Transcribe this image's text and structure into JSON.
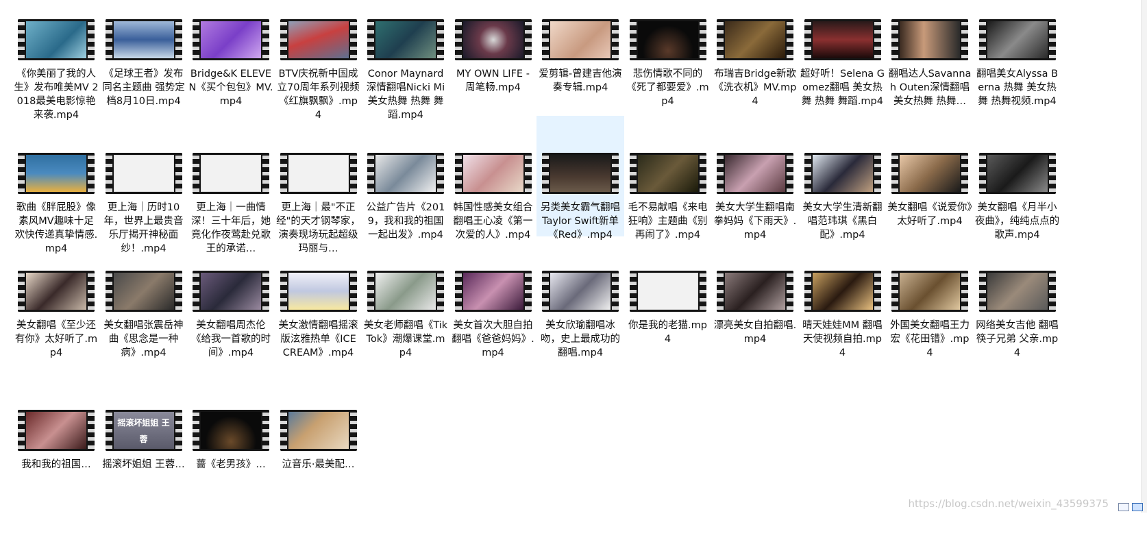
{
  "files": [
    {
      "caption": "《你美丽了我的人生》发布唯美MV 2018最美电影惊艳来袭.mp4",
      "bg": "linear-gradient(135deg,#6fb0c8,#2a6a8a 60%,#9fd0e0)"
    },
    {
      "caption": "《足球王者》发布同名主题曲 强势定档8月10日.mp4",
      "bg": "linear-gradient(180deg,#9fb8d8,#3a5f9a 50%,#c8d8e8)"
    },
    {
      "caption": "Bridge&K ELEVEN《买个包包》MV.mp4",
      "bg": "linear-gradient(135deg,#b07ae0,#7a3fc8 50%,#d0a8f0)"
    },
    {
      "caption": "BTV庆祝新中国成立70周年系列视频《红旗飘飘》.mp4",
      "bg": "linear-gradient(160deg,#8fa0b8,#c84040 45%,#5f7090)"
    },
    {
      "caption": "Conor Maynard深情翻唱Nicki Mi 美女热舞 热舞 舞蹈.mp4",
      "bg": "linear-gradient(135deg,#2f6f6f,#1f3f4f 50%,#6f8f7f)"
    },
    {
      "caption": "MY OWN LIFE - 周笔畅.mp4",
      "bg": "radial-gradient(circle at 50% 50%,#d8d8d8,#6a3a4a 40%,#1a1a2a)"
    },
    {
      "caption": "爱剪辑-曾建吉他演奏专辑.mp4",
      "bg": "linear-gradient(135deg,#f0d8c8,#c89a80 60%,#e8c8b8)"
    },
    {
      "caption": "悲伤情歌不同的《死了都要爱》.mp4",
      "bg": "radial-gradient(circle at 50% 80%,#5a3a2a,#0a0a0a 60%)"
    },
    {
      "caption": "布瑞吉Bridge新歌《洗衣机》MV.mp4",
      "bg": "linear-gradient(135deg,#3a2a1a,#8a6a3a 50%,#2a1a0a)"
    },
    {
      "caption": "超好听！Selena Gomez翻唱 美女热舞 热舞 舞蹈.mp4",
      "bg": "linear-gradient(180deg,#2a1a1a,#8a3030 50%,#1a0a0a)"
    },
    {
      "caption": "翻唱达人Savannah Outen深情翻唱 美女热舞 热舞…",
      "bg": "linear-gradient(90deg,#3a2a20,#c89a7a 40%,#2a2a2a)"
    },
    {
      "caption": "翻唱美女Alyssa Berna 热舞 美女热舞 热舞视频.mp4",
      "bg": "linear-gradient(135deg,#1a1a1a,#8a8a8a 50%,#2a2a2a)"
    },
    {
      "caption": "歌曲《胖屁股》像素风MV趣味十足 欢快传递真挚情感.mp4",
      "bg": "linear-gradient(180deg,#2f6fa0,#4a8ac0 50%,#e8b040)"
    },
    {
      "caption": "更上海｜历时10年，世界上最贵音乐厅揭开神秘面纱！.mp4",
      "bg": "",
      "plain": true
    },
    {
      "caption": "更上海｜一曲情深！三十年后，她竟化作夜莺赴兑歌王的承诺…",
      "bg": "",
      "plain": true
    },
    {
      "caption": "更上海｜最\"不正经\"的天才钢琴家，演奏现场玩起超级玛丽与…",
      "bg": "",
      "plain": true
    },
    {
      "caption": "公益广告片《2019，我和我的祖国一起出发》.mp4",
      "bg": "linear-gradient(135deg,#e8e8e8,#7a8a9a 50%,#f0f0f0)"
    },
    {
      "caption": "韩国性感美女组合翻唱王心凌《第一次爱的人》.mp4",
      "bg": "linear-gradient(135deg,#f0e0e8,#c89090 50%,#e8d8c8)"
    },
    {
      "caption": "另类美女霸气翻唱Taylor Swift新单《Red》.mp4",
      "bg": "linear-gradient(180deg,#1a1a1a,#4a3a30 60%,#6a5a4a)",
      "selected": true
    },
    {
      "caption": "毛不易献唱《来电狂响》主题曲《别再闹了》.mp4",
      "bg": "linear-gradient(135deg,#2a2a1a,#6a5a3a 50%,#1a1a0a)"
    },
    {
      "caption": "美女大学生翻唱南拳妈妈《下雨天》.mp4",
      "bg": "linear-gradient(135deg,#3a2a30,#c8a0b0 50%,#5a3a40)"
    },
    {
      "caption": "美女大学生清新翻唱范玮琪《黑白配》.mp4",
      "bg": "linear-gradient(135deg,#e0e8f0,#2a2a3a 50%,#c0a080)"
    },
    {
      "caption": "美女翻唱《说爱你》太好听了.mp4",
      "bg": "linear-gradient(135deg,#e8c8a8,#8a6a4a 50%,#1a1a1a)"
    },
    {
      "caption": "美女翻唱《月半小夜曲》，纯纯点点的歌声.mp4",
      "bg": "linear-gradient(135deg,#5a5a5a,#1a1a1a 50%,#8a8a8a)"
    },
    {
      "caption": "美女翻唱《至少还有你》太好听了.mp4",
      "bg": "linear-gradient(135deg,#e8d8c8,#3a2a2a 50%,#c8b8a8)"
    },
    {
      "caption": "美女翻唱张震岳神曲《思念是一种病》.mp4",
      "bg": "linear-gradient(135deg,#4a4a4a,#8a7a6a 50%,#2a2a2a)"
    },
    {
      "caption": "美女翻唱周杰伦《给我一首歌的时间》.mp4",
      "bg": "linear-gradient(135deg,#6a5a7a,#2a2a3a 50%,#9a8aa0)"
    },
    {
      "caption": "美女激情翻唱摇滚版泫雅热单《ICE CREAM》.mp4",
      "bg": "linear-gradient(180deg,#f0f0f8,#c0c8e0 50%,#f8e8a0)"
    },
    {
      "caption": "美女老师翻唱《TikTok》潮爆课堂.mp4",
      "bg": "linear-gradient(135deg,#f0f0f0,#8a9a8a 50%,#e8e8e8)"
    },
    {
      "caption": "美女首次大胆自拍翻唱《爸爸妈妈》.mp4",
      "bg": "linear-gradient(135deg,#5a2a5a,#c890b0 50%,#3a1a3a)"
    },
    {
      "caption": "美女欣瑜翻唱冰吻，史上最成功的翻唱.mp4",
      "bg": "linear-gradient(135deg,#e8e8f0,#6a6a7a 50%,#f0f0f0)"
    },
    {
      "caption": "你是我的老猫.mp4",
      "bg": "",
      "plain": true
    },
    {
      "caption": "漂亮美女自拍翻唱.mp4",
      "bg": "linear-gradient(135deg,#8a7a7a,#2a2020 50%,#b0a0a0)"
    },
    {
      "caption": "晴天娃娃MM 翻唱天使视频自拍.mp4",
      "bg": "linear-gradient(135deg,#c8a060,#2a1a10 50%,#e8c080)"
    },
    {
      "caption": "外国美女翻唱王力宏《花田错》.mp4",
      "bg": "linear-gradient(135deg,#c8b090,#6a5030 50%,#e0c8a0)"
    },
    {
      "caption": "网络美女吉他 翻唱 筷子兄弟 父亲.mp4",
      "bg": "linear-gradient(135deg,#3a3a3a,#9a8a7a 50%,#5a5a5a)"
    },
    {
      "caption": "我和我的祖国…",
      "bg": "linear-gradient(135deg,#6a2a2a,#c89090 50%,#3a1a1a)"
    },
    {
      "caption": "摇滚坏姐姐 王蓉…",
      "bg": "linear-gradient(180deg,#8a8a9a,#5a5a6a)",
      "overlay": "摇滚坏姐姐  王 蓉"
    },
    {
      "caption": "蔷《老男孩》…",
      "bg": "radial-gradient(circle at 50% 80%,#6a4a2a,#0a0a0a 60%)"
    },
    {
      "caption": "泣音乐·最美配…",
      "bg": "linear-gradient(135deg,#5a7a9a,#c8a070 40%,#e8d8c0)"
    }
  ],
  "watermark": "https://blog.csdn.net/weixin_43599375"
}
